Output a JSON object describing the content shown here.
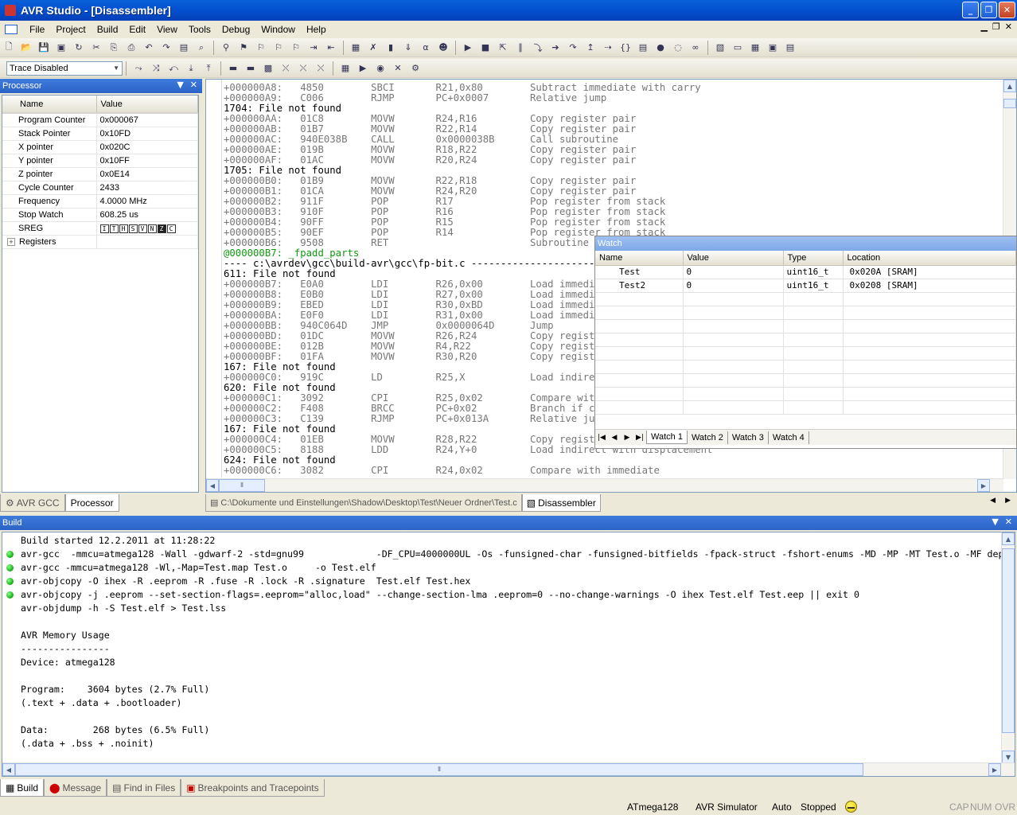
{
  "window": {
    "title": "AVR Studio - [Disassembler]"
  },
  "menu": [
    "File",
    "Project",
    "Build",
    "Edit",
    "View",
    "Tools",
    "Debug",
    "Window",
    "Help"
  ],
  "toolbar2": {
    "trace_select": "Trace Disabled"
  },
  "processor": {
    "title": "Processor",
    "columns": [
      "Name",
      "Value"
    ],
    "rows": [
      {
        "name": "Program Counter",
        "value": "0x000067"
      },
      {
        "name": "Stack Pointer",
        "value": "0x10FD"
      },
      {
        "name": "X pointer",
        "value": "0x020C"
      },
      {
        "name": "Y pointer",
        "value": "0x10FF"
      },
      {
        "name": "Z pointer",
        "value": "0x0E14"
      },
      {
        "name": "Cycle Counter",
        "value": "2433"
      },
      {
        "name": "Frequency",
        "value": "4.0000 MHz"
      },
      {
        "name": "Stop Watch",
        "value": "608.25 us"
      }
    ],
    "sreg": {
      "name": "SREG",
      "bits": [
        "I",
        "T",
        "H",
        "S",
        "V",
        "N",
        "Z",
        "C"
      ],
      "set": [
        false,
        false,
        false,
        false,
        false,
        false,
        true,
        false
      ]
    },
    "registers": {
      "name": "Registers",
      "expander": "+"
    }
  },
  "left_tabs": [
    {
      "label": "AVR GCC"
    },
    {
      "label": "Processor"
    }
  ],
  "disasm_lines": [
    {
      "kind": "asm",
      "text": "+000000A8:   4850        SBCI       R21,0x80        Subtract immediate with carry"
    },
    {
      "kind": "asm",
      "text": "+000000A9:   C006        RJMP       PC+0x0007       Relative jump"
    },
    {
      "kind": "lbl",
      "text": "1704: File not found"
    },
    {
      "kind": "asm",
      "text": "+000000AA:   01C8        MOVW       R24,R16         Copy register pair"
    },
    {
      "kind": "asm",
      "text": "+000000AB:   01B7        MOVW       R22,R14         Copy register pair"
    },
    {
      "kind": "asm",
      "text": "+000000AC:   940E038B    CALL       0x0000038B      Call subroutine"
    },
    {
      "kind": "asm",
      "text": "+000000AE:   019B        MOVW       R18,R22         Copy register pair"
    },
    {
      "kind": "asm",
      "text": "+000000AF:   01AC        MOVW       R20,R24         Copy register pair"
    },
    {
      "kind": "lbl",
      "text": "1705: File not found"
    },
    {
      "kind": "asm",
      "text": "+000000B0:   01B9        MOVW       R22,R18         Copy register pair"
    },
    {
      "kind": "asm",
      "text": "+000000B1:   01CA        MOVW       R24,R20         Copy register pair"
    },
    {
      "kind": "asm",
      "text": "+000000B2:   911F        POP        R17             Pop register from stack"
    },
    {
      "kind": "asm",
      "text": "+000000B3:   910F        POP        R16             Pop register from stack"
    },
    {
      "kind": "asm",
      "text": "+000000B4:   90FF        POP        R15             Pop register from stack"
    },
    {
      "kind": "asm",
      "text": "+000000B5:   90EF        POP        R14             Pop register from stack"
    },
    {
      "kind": "asm",
      "text": "+000000B6:   9508        RET                        Subroutine return"
    },
    {
      "kind": "sym",
      "text": "@000000B7: _fpadd_parts"
    },
    {
      "kind": "src",
      "text": "---- c:\\avrdev\\gcc\\build-avr\\gcc\\fp-bit.c -------------------------------------------"
    },
    {
      "kind": "lbl",
      "text": "611: File not found"
    },
    {
      "kind": "asm",
      "text": "+000000B7:   E0A0        LDI        R26,0x00        Load immediate"
    },
    {
      "kind": "asm",
      "text": "+000000B8:   E0B0        LDI        R27,0x00        Load immediate"
    },
    {
      "kind": "asm",
      "text": "+000000B9:   EBED        LDI        R30,0xBD        Load immediate"
    },
    {
      "kind": "asm",
      "text": "+000000BA:   E0F0        LDI        R31,0x00        Load immediate"
    },
    {
      "kind": "asm",
      "text": "+000000BB:   940C064D    JMP        0x0000064D      Jump"
    },
    {
      "kind": "asm",
      "text": "+000000BD:   01DC        MOVW       R26,R24         Copy register pair"
    },
    {
      "kind": "asm",
      "text": "+000000BE:   012B        MOVW       R4,R22          Copy register pair"
    },
    {
      "kind": "asm",
      "text": "+000000BF:   01FA        MOVW       R30,R20         Copy register pair"
    },
    {
      "kind": "lbl",
      "text": "167: File not found"
    },
    {
      "kind": "asm",
      "text": "+000000C0:   919C        LD         R25,X           Load indirect"
    },
    {
      "kind": "lbl",
      "text": "620: File not found"
    },
    {
      "kind": "asm",
      "text": "+000000C1:   3092        CPI        R25,0x02        Compare with immediate"
    },
    {
      "kind": "asm",
      "text": "+000000C2:   F408        BRCC       PC+0x02         Branch if carry cleared"
    },
    {
      "kind": "asm",
      "text": "+000000C3:   C139        RJMP       PC+0x013A       Relative jump"
    },
    {
      "kind": "lbl",
      "text": "167: File not found"
    },
    {
      "kind": "asm",
      "text": "+000000C4:   01EB        MOVW       R28,R22         Copy register pair"
    },
    {
      "kind": "asm",
      "text": "+000000C5:   8188        LDD        R24,Y+0         Load indirect with displacement"
    },
    {
      "kind": "lbl",
      "text": "624: File not found"
    },
    {
      "kind": "asm",
      "text": "+000000C6:   3082        CPI        R24,0x02        Compare with immediate"
    }
  ],
  "watch": {
    "title": "Watch",
    "columns": [
      "Name",
      "Value",
      "Type",
      "Location"
    ],
    "rows": [
      {
        "name": "Test",
        "value": "0",
        "type": "uint16_t",
        "location": "0x020A [SRAM]"
      },
      {
        "name": "Test2",
        "value": "0",
        "type": "uint16_t",
        "location": "0x0208 [SRAM]"
      }
    ],
    "tabs": [
      "Watch 1",
      "Watch 2",
      "Watch 3",
      "Watch 4"
    ]
  },
  "doc_tabs": [
    {
      "label": "C:\\Dokumente und Einstellungen\\Shadow\\Desktop\\Test\\Neuer Ordner\\Test.c"
    },
    {
      "label": "Disassembler"
    }
  ],
  "build": {
    "title": "Build",
    "lines": [
      {
        "dot": false,
        "text": "Build started 12.2.2011 at 11:28:22"
      },
      {
        "dot": true,
        "text": "avr-gcc  -mmcu=atmega128 -Wall -gdwarf-2 -std=gnu99             -DF_CPU=4000000UL -Os -funsigned-char -funsigned-bitfields -fpack-struct -fshort-enums -MD -MP -MT Test.o -MF dep/Test.o.d  -c  ../Test.c"
      },
      {
        "dot": true,
        "text": "avr-gcc -mmcu=atmega128 -Wl,-Map=Test.map Test.o     -o Test.elf"
      },
      {
        "dot": true,
        "text": "avr-objcopy -O ihex -R .eeprom -R .fuse -R .lock -R .signature  Test.elf Test.hex"
      },
      {
        "dot": true,
        "text": "avr-objcopy -j .eeprom --set-section-flags=.eeprom=\"alloc,load\" --change-section-lma .eeprom=0 --no-change-warnings -O ihex Test.elf Test.eep || exit 0"
      },
      {
        "dot": false,
        "text": "avr-objdump -h -S Test.elf > Test.lss"
      },
      {
        "dot": false,
        "text": ""
      },
      {
        "dot": false,
        "text": "AVR Memory Usage"
      },
      {
        "dot": false,
        "text": "----------------"
      },
      {
        "dot": false,
        "text": "Device: atmega128"
      },
      {
        "dot": false,
        "text": ""
      },
      {
        "dot": false,
        "text": "Program:    3604 bytes (2.7% Full)"
      },
      {
        "dot": false,
        "text": "(.text + .data + .bootloader)"
      },
      {
        "dot": false,
        "text": ""
      },
      {
        "dot": false,
        "text": "Data:        268 bytes (6.5% Full)"
      },
      {
        "dot": false,
        "text": "(.data + .bss + .noinit)"
      }
    ]
  },
  "bottom_tabs": [
    {
      "label": "Build"
    },
    {
      "label": "Message"
    },
    {
      "label": "Find in Files"
    },
    {
      "label": "Breakpoints and Tracepoints"
    }
  ],
  "status": {
    "device": "ATmega128",
    "platform": "AVR Simulator",
    "mode": "Auto",
    "state": "Stopped",
    "caps": "CAP",
    "num": "NUM",
    "ovr": "OVR"
  }
}
